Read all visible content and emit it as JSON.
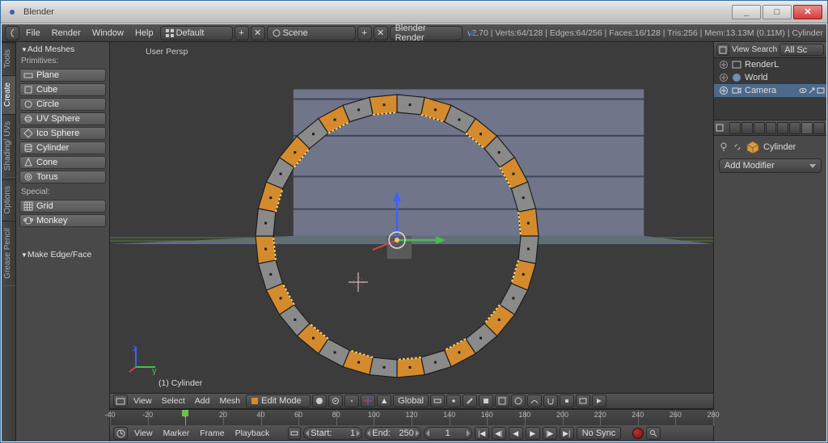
{
  "window": {
    "title": "Blender"
  },
  "info_header": {
    "menus": [
      "File",
      "Render",
      "Window",
      "Help"
    ],
    "screen_layout": "Default",
    "scene": "Scene",
    "renderer": "Blender Render",
    "stats": "v2.70 | Verts:64/128 | Edges:64/256 | Faces:16/128 | Tris:256 | Mem:13.13M (0.11M) | Cylinder"
  },
  "vtabs": [
    "Tools",
    "Create",
    "Shading/ UVs",
    "Options",
    "Grease Pencil"
  ],
  "toolshelf": {
    "panel1_title": "Add Meshes",
    "primitives_label": "Primitives:",
    "primitives": [
      "Plane",
      "Cube",
      "Circle",
      "UV Sphere",
      "Ico Sphere",
      "Cylinder",
      "Cone",
      "Torus"
    ],
    "special_label": "Special:",
    "special": [
      "Grid",
      "Monkey"
    ],
    "panel2_title": "Make Edge/Face"
  },
  "viewport": {
    "persp_label": "User Persp",
    "object_label": "(1) Cylinder"
  },
  "v3d_header": {
    "menus": [
      "View",
      "Select",
      "Add",
      "Mesh"
    ],
    "mode": "Edit Mode",
    "orientation": "Global"
  },
  "timeline": {
    "menus": [
      "View",
      "Marker",
      "Frame",
      "Playback"
    ],
    "start_label": "Start:",
    "start_value": "1",
    "end_label": "End:",
    "end_value": "250",
    "current_value": "1",
    "sync": "No Sync",
    "ticks": [
      -40,
      -20,
      0,
      20,
      40,
      60,
      80,
      100,
      120,
      140,
      160,
      180,
      200,
      220,
      240,
      260,
      280
    ],
    "cursor_frame": 0
  },
  "outliner": {
    "header": {
      "view": "View",
      "search": "Search",
      "filter": "All Sc"
    },
    "items": [
      {
        "name": "RenderL",
        "icon": "image",
        "sel": false
      },
      {
        "name": "World",
        "icon": "world",
        "sel": false
      },
      {
        "name": "Camera",
        "icon": "camera",
        "sel": true
      }
    ]
  },
  "properties": {
    "context": "modifier",
    "object_icon": "cube",
    "link_icon": "link",
    "pin_icon": "pin",
    "object_name": "Cylinder",
    "add_modifier_label": "Add Modifier"
  },
  "colors": {
    "accent_orange": "#ff9a2e",
    "select_blue": "#4d6a8c"
  }
}
